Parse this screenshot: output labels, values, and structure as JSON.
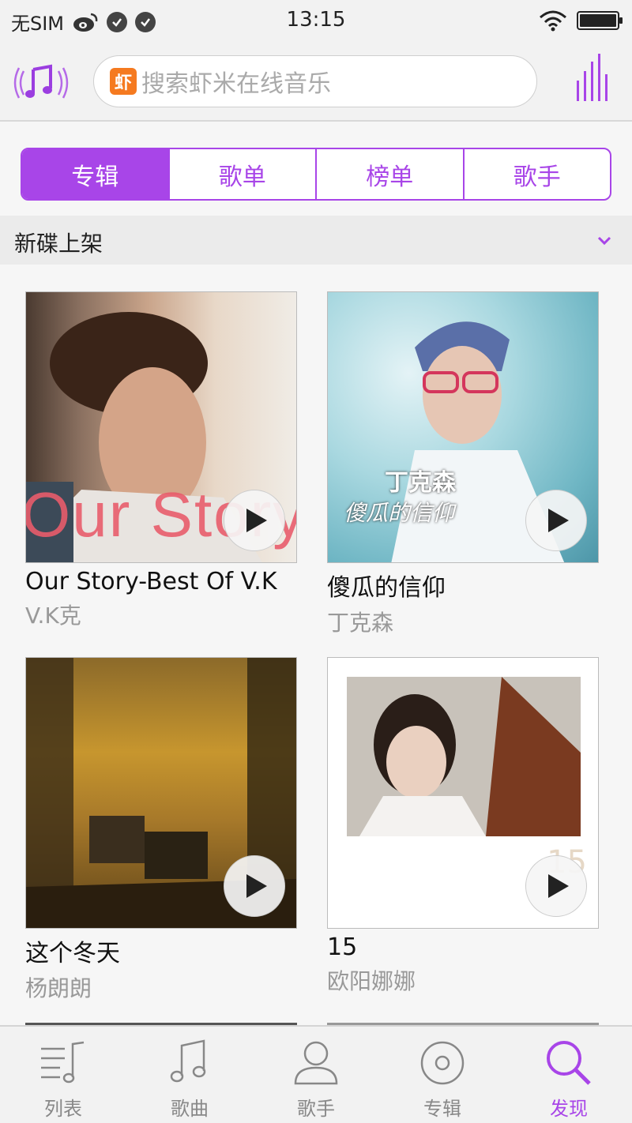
{
  "status_bar": {
    "carrier": "无SIM",
    "time": "13:15"
  },
  "search": {
    "badge": "虾",
    "placeholder": "搜索虾米在线音乐"
  },
  "tabs": [
    {
      "label": "专辑",
      "active": true
    },
    {
      "label": "歌单",
      "active": false
    },
    {
      "label": "榜单",
      "active": false
    },
    {
      "label": "歌手",
      "active": false
    }
  ],
  "section": {
    "title": "新碟上架"
  },
  "albums": [
    {
      "title": "Our Story-Best Of V.K",
      "artist": "V.K克",
      "cover_text": "Our Story"
    },
    {
      "title": "傻瓜的信仰",
      "artist": "丁克森",
      "cover_text": "丁克森",
      "cover_subtext": "傻瓜的信仰"
    },
    {
      "title": "这个冬天",
      "artist": "杨朗朗"
    },
    {
      "title": "15",
      "artist": "欧阳娜娜",
      "cover_text": "15"
    }
  ],
  "bottom_nav": [
    {
      "label": "列表",
      "icon": "list-music-icon",
      "active": false
    },
    {
      "label": "歌曲",
      "icon": "music-note-icon",
      "active": false
    },
    {
      "label": "歌手",
      "icon": "person-icon",
      "active": false
    },
    {
      "label": "专辑",
      "icon": "disc-icon",
      "active": false
    },
    {
      "label": "发现",
      "icon": "search-icon",
      "active": true
    }
  ],
  "colors": {
    "accent": "#a845e8",
    "xiami_orange": "#f57a20"
  }
}
